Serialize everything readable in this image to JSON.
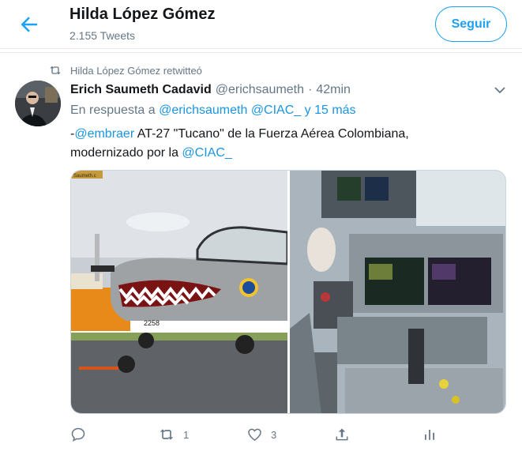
{
  "header": {
    "title": "Hilda López Gómez",
    "tweet_count": "2.155 Tweets",
    "follow_label": "Seguir",
    "back_icon": "arrow-left-icon"
  },
  "tweet": {
    "retweet_notice": "Hilda López Gómez retwitteó",
    "author_name": "Erich Saumeth Cadavid",
    "author_handle": "@erichsaumeth",
    "dot": "·",
    "time": "42min",
    "reply_prefix": "En respuesta a",
    "reply_handles": "@erichsaumeth @CIAC_ y 15 más",
    "text_prefix": "-",
    "mention_embraer": "@embraer",
    "text_body": " AT-27 \"Tucano\" de la Fuerza Aérea Colombiana, modernizado por la ",
    "mention_ciac": "@CIAC_",
    "image_left_alt": "Avión Tucano con boca de tiburón",
    "image_right_alt": "Cabina del Tucano",
    "watermark_text": "Saumeth.c",
    "aircraft_number": "2258"
  },
  "actions": {
    "reply_count": "",
    "retweet_count": "1",
    "like_count": "3",
    "share_count": "",
    "analytics_count": ""
  },
  "colors": {
    "accent": "#1da1f2",
    "link": "#1b95e0",
    "muted": "#657786",
    "text": "#14171a",
    "border": "#e6ecf0"
  }
}
